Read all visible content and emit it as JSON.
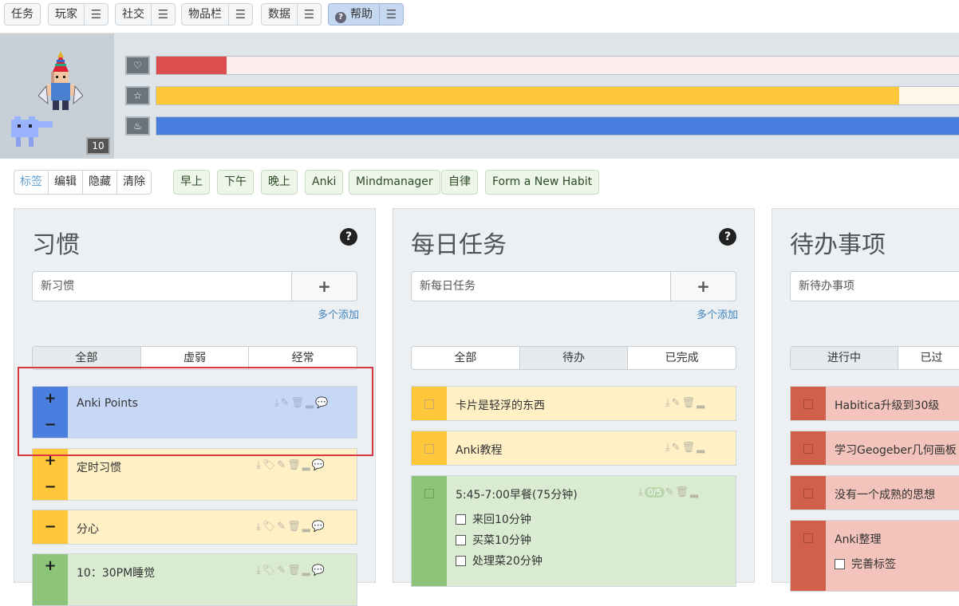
{
  "menu": {
    "tasks": "任务",
    "player": "玩家",
    "social": "社交",
    "inventory": "物品栏",
    "data": "数据",
    "help": "帮助",
    "help_icon": "?",
    "menu_icon": "☰"
  },
  "avatar": {
    "level": "10"
  },
  "stats": {
    "health_fraction": 0.087,
    "experience_fraction": 0.925,
    "mana_fraction": 1.0,
    "colors": {
      "health": "#dc4d4d",
      "experience": "#ffc73a",
      "mana": "#4a7fe0",
      "health_track": "#fdeeee",
      "exp_track": "#fff8ea"
    }
  },
  "tags": {
    "group": [
      "标签",
      "编辑",
      "隐藏",
      "清除"
    ],
    "items": [
      "早上",
      "下午",
      "晚上",
      "Anki",
      "Mindmanager",
      "自律",
      "Form a New Habit"
    ]
  },
  "habits": {
    "title": "习惯",
    "add_placeholder": "新习惯",
    "plus": "+",
    "multi_add": "多个添加",
    "tabs": [
      "全部",
      "虚弱",
      "经常"
    ],
    "items": [
      {
        "text": "Anki Points"
      },
      {
        "text": "定时习惯"
      },
      {
        "text": "分心"
      },
      {
        "text": "10：30PM睡觉"
      }
    ]
  },
  "dailies": {
    "title": "每日任务",
    "add_placeholder": "新每日任务",
    "plus": "+",
    "multi_add": "多个添加",
    "tabs": [
      "全部",
      "待办",
      "已完成"
    ],
    "items": [
      {
        "text": "卡片是轻浮的东西"
      },
      {
        "text": "Anki教程"
      },
      {
        "text": "5:45-7:00早餐(75分钟)",
        "counter": "0/5",
        "checklist": [
          "来回10分钟",
          "买菜10分钟",
          "处理菜20分钟"
        ]
      }
    ]
  },
  "todos": {
    "title": "待办事项",
    "add_placeholder": "新待办事项",
    "tabs": [
      "进行中",
      "已过"
    ],
    "items": [
      {
        "text": "Habitica升级到30级"
      },
      {
        "text": "学习Geogeber几何画板"
      },
      {
        "text": "没有一个成熟的思想"
      },
      {
        "text": "Anki整理",
        "checklist": [
          "完善标签"
        ]
      }
    ]
  },
  "icons": {
    "heart": "heart-icon",
    "star": "star-icon",
    "fire": "fire-icon"
  }
}
